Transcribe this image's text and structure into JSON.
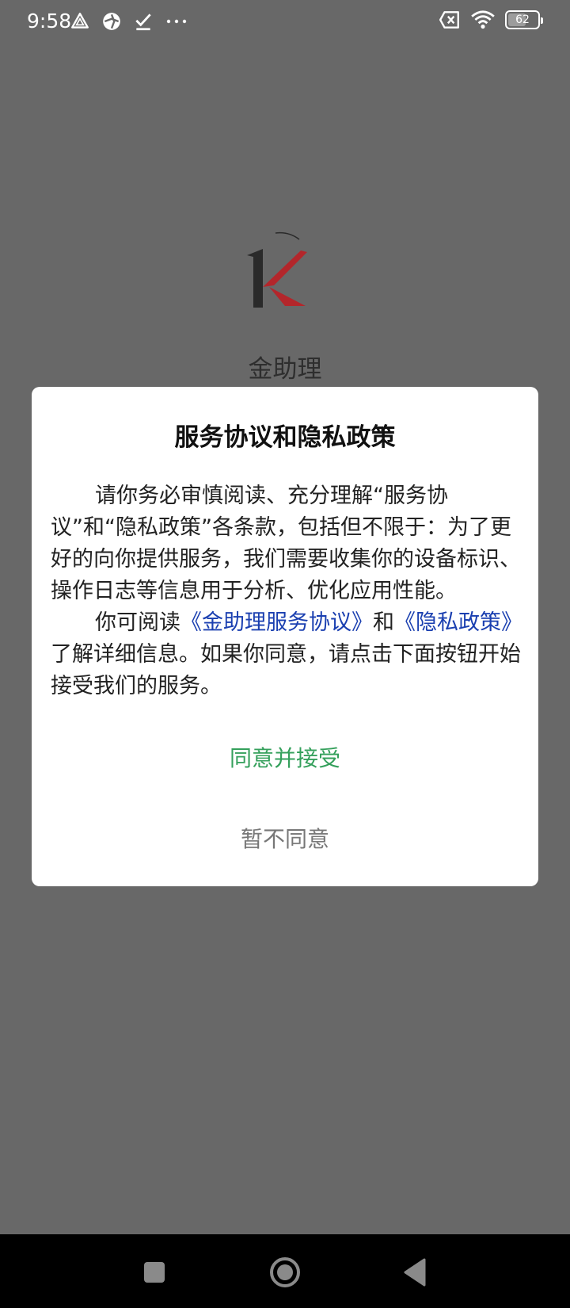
{
  "status_bar": {
    "time": "9:58",
    "battery_level": 62,
    "battery_label": "62",
    "icons": [
      "drive-icon",
      "sync-icon",
      "check-icon",
      "more-icon",
      "sim-off-icon",
      "wifi-icon",
      "battery-icon"
    ]
  },
  "app": {
    "name": "金助理",
    "logo_icon": "k-logo-icon",
    "logo_colors": {
      "dark": "#2a2a2a",
      "accent": "#b3262b"
    }
  },
  "dialog": {
    "title": "服务协议和隐私政策",
    "para1": "请你务必审慎阅读、充分理解“服务协议”和“隐私政策”各条款，包括但不限于：为了更好的向你提供服务，我们需要收集你的设备标识、操作日志等信息用于分析、优化应用性能。",
    "para2_prefix": "你可阅读",
    "link_service": "《金助理服务协议》",
    "para2_and": "和",
    "link_privacy": "《隐私政策》",
    "para2_suffix": "了解详细信息。如果你同意，请点击下面按钮开始接受我们的服务。",
    "agree_label": "同意并接受",
    "decline_label": "暂不同意"
  },
  "colors": {
    "backdrop": "#686868",
    "agree": "#35a05c",
    "link": "#1a3fb0",
    "decline": "#777777"
  },
  "nav_bar": {
    "buttons": [
      "recent-apps-icon",
      "home-icon",
      "back-icon"
    ]
  }
}
